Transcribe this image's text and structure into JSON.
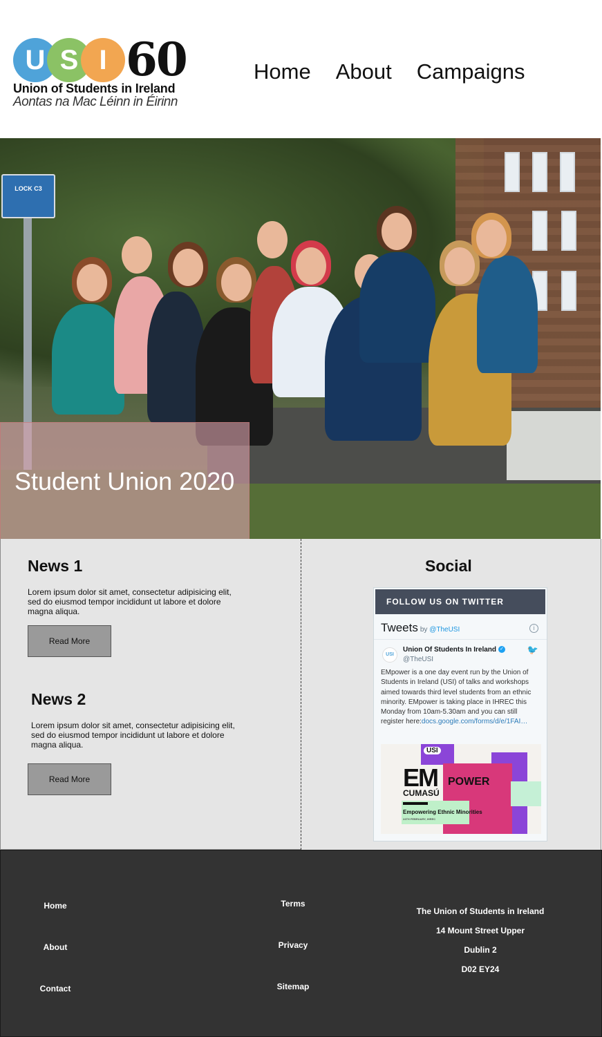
{
  "header": {
    "logo": {
      "letters": [
        "U",
        "S",
        "I"
      ],
      "anniversary": "60",
      "name_en": "Union of Students in Ireland",
      "name_ga": "Aontas na Mac Léinn in Éirinn",
      "colors": {
        "u": "#4fa3d9",
        "s": "#8bc265",
        "i": "#f2a651"
      }
    },
    "nav": [
      "Home",
      "About",
      "Campaigns"
    ]
  },
  "hero": {
    "title": "Student Union 2020",
    "sign_text": "LOCK C3"
  },
  "news": [
    {
      "title": "News 1",
      "body": "Lorem ipsum dolor sit amet, consectetur adipisicing elit, sed do eiusmod tempor incididunt ut labore et dolore magna aliqua.",
      "button": "Read More"
    },
    {
      "title": "News 2",
      "body": "Lorem ipsum dolor sit amet, consectetur adipisicing elit, sed do eiusmod tempor incididunt ut labore et dolore magna aliqua.",
      "button": "Read More"
    }
  ],
  "social": {
    "title": "Social",
    "twitter": {
      "header": "FOLLOW US ON TWITTER",
      "tweets_label": "Tweets",
      "by_label": "by",
      "by_handle": "@TheUSI",
      "account_name": "Union Of Students In Ireland",
      "account_handle": "@TheUSI",
      "tweet_text": "EMpower is a one day event run by the Union of Students in Ireland (USI) of talks and workshops aimed towards third level students from an ethnic minority. EMpower is taking place in IHREC this Monday from 10am-5.30am and you can still register here:",
      "tweet_link": "docs.google.com/forms/d/e/1FAI…",
      "image": {
        "logo": "USI",
        "em": "EM",
        "power": "POWER",
        "cumasu": "CUMASÚ",
        "tagline": "Empowering Ethnic Minorities",
        "date": "24TH FEBRUARY, IHREC"
      }
    }
  },
  "footer": {
    "col1": [
      "Home",
      "About",
      "Contact"
    ],
    "col2": [
      "Terms",
      "Privacy",
      "Sitemap"
    ],
    "address": [
      "The Union of Students in Ireland",
      "14 Mount Street Upper",
      "Dublin 2",
      "D02 EY24"
    ]
  }
}
